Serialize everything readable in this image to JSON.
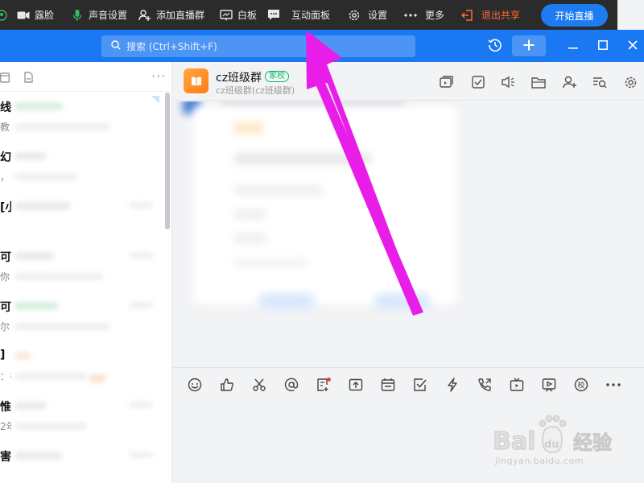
{
  "toolbar": {
    "beauty_label": "露脸",
    "sound_label": "声音设置",
    "add_group_label": "添加直播群",
    "whiteboard_label": "白板",
    "interactive_label": "互动面板",
    "settings_label": "设置",
    "more_label": "更多",
    "exit_share_label": "退出共享",
    "start_live_label": "开始直播"
  },
  "title_bar": {
    "search_placeholder": "搜索 (Ctrl+Shift+F)"
  },
  "conversations": [
    {
      "name": "线",
      "preview": "教"
    },
    {
      "name": "幻",
      "preview": "，"
    },
    {
      "name": "[小",
      "preview": ""
    },
    {
      "name": "可小",
      "preview": "你"
    },
    {
      "name": "可企",
      "preview": "尔"
    },
    {
      "name": "]",
      "preview": "：在"
    },
    {
      "name": "惟",
      "preview": "2年"
    },
    {
      "name": "害",
      "preview": ""
    }
  ],
  "chat": {
    "group_name": "cz班级群",
    "badge": "家校",
    "subtitle": "cz班级群(cz班级群)"
  },
  "watermark": {
    "brand_latin": "Bai",
    "brand_du": "du",
    "brand_cn": "经验",
    "url": "jingyan.baidu.com"
  },
  "colors": {
    "toolbar_bg": "#2b2b2b",
    "title_bar_bg": "#1a78f2",
    "accent_blue": "#1e7cf2",
    "exit_orange": "#ff6a3d",
    "arrow_magenta": "#e81ee8",
    "badge_green": "#18b06b"
  }
}
